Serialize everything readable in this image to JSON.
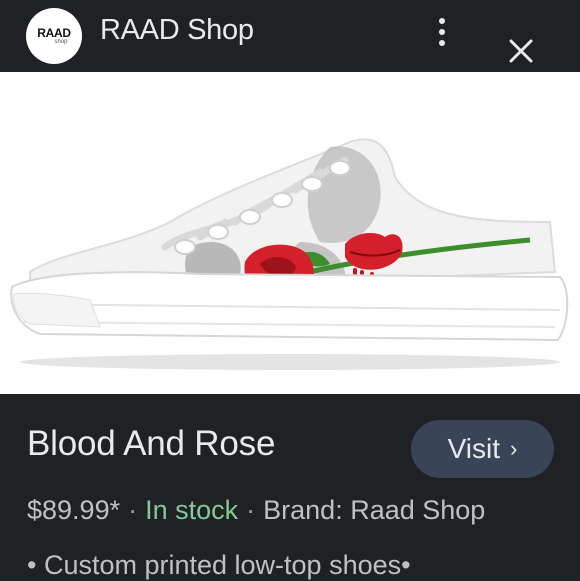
{
  "header": {
    "logo_text": "RAAD",
    "logo_subtext": "shop",
    "site_title": "RAAD Shop",
    "more_icon": "more-vert-icon",
    "close_icon": "close-icon"
  },
  "product": {
    "image_alt": "Blood And Rose low-top sneaker",
    "title": "Blood And Rose",
    "visit_label": "Visit",
    "visit_chevron": "›",
    "price": "$89.99*",
    "separator": "·",
    "stock_status": "In stock",
    "brand": "Brand: Raad Shop",
    "description": "• Custom printed low-top shoes•"
  },
  "colors": {
    "background": "#202124",
    "text_primary": "#e8eaed",
    "text_secondary": "#bdc1c6",
    "stock_green": "#81c995",
    "visit_button": "#394457"
  }
}
